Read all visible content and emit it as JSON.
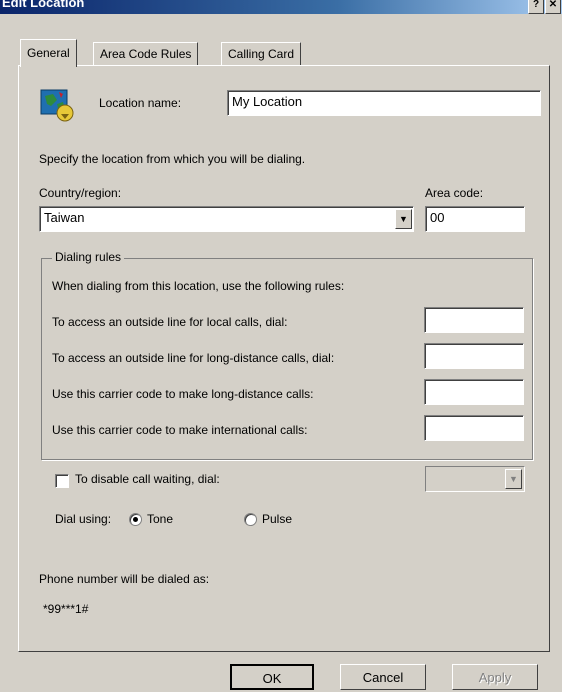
{
  "window": {
    "title": "Edit Location",
    "help_btn": "?",
    "close_btn": "✕"
  },
  "tabs": [
    "General",
    "Area Code Rules",
    "Calling Card"
  ],
  "location": {
    "label": "Location name:",
    "value": "My Location"
  },
  "instruction": "Specify the location from which you will be dialing.",
  "country": {
    "label": "Country/region:",
    "value": "Taiwan"
  },
  "area_code": {
    "label": "Area code:",
    "value": "00"
  },
  "dialing_rules": {
    "legend": "Dialing rules",
    "intro": "When dialing from this location, use the following rules:",
    "rows": [
      {
        "label": "To access an outside line for local calls, dial:",
        "value": ""
      },
      {
        "label": "To access an outside line for long-distance calls, dial:",
        "value": ""
      },
      {
        "label": "Use this carrier code to make long-distance calls:",
        "value": ""
      },
      {
        "label": "Use this carrier code to make international calls:",
        "value": ""
      }
    ]
  },
  "call_waiting": {
    "label": "To disable call waiting, dial:",
    "checked": false
  },
  "dial_using": {
    "label": "Dial using:",
    "options": [
      {
        "label": "Tone",
        "selected": true
      },
      {
        "label": "Pulse",
        "selected": false
      }
    ]
  },
  "phone_preview": {
    "label": "Phone number will be dialed as:",
    "value": "*99***1#"
  },
  "buttons": {
    "ok": "OK",
    "cancel": "Cancel",
    "apply": "Apply"
  },
  "icons": {
    "location": "location-globe-icon"
  }
}
